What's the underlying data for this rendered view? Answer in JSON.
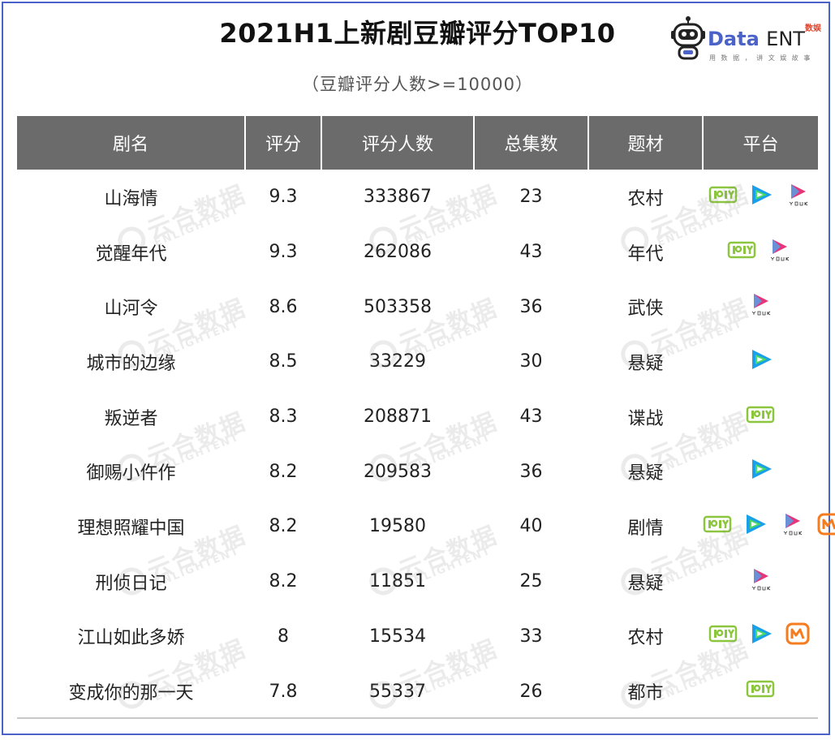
{
  "title": "2021H1上新剧豆瓣评分TOP10",
  "subtitle": "（豆瓣评分人数>=10000）",
  "logo": {
    "brand_data": "Data",
    "brand_ent": "ENT",
    "badge": "数娱",
    "tagline": "用 数 据 ， 讲 文 娱 故 事"
  },
  "watermark": {
    "cn": "云合数据",
    "en": "ENLIGHTENT"
  },
  "colors": {
    "header_bg": "#6b6b6b",
    "frame": "#4b63c9",
    "iqiyi": "#8cc63f",
    "youku": "#e6367a",
    "tencent": "#1aa0e8",
    "mango": "#f57c1f"
  },
  "chart_data": {
    "type": "table",
    "columns": [
      "剧名",
      "评分",
      "评分人数",
      "总集数",
      "题材",
      "平台"
    ],
    "rows": [
      {
        "name": "山海情",
        "score": "9.3",
        "raters": "333867",
        "episodes": "23",
        "genre": "农村",
        "platforms": [
          "iqiyi",
          "tencent",
          "youku"
        ]
      },
      {
        "name": "觉醒年代",
        "score": "9.3",
        "raters": "262086",
        "episodes": "43",
        "genre": "年代",
        "platforms": [
          "iqiyi",
          "youku"
        ]
      },
      {
        "name": "山河令",
        "score": "8.6",
        "raters": "503358",
        "episodes": "36",
        "genre": "武侠",
        "platforms": [
          "youku"
        ]
      },
      {
        "name": "城市的边缘",
        "score": "8.5",
        "raters": "33229",
        "episodes": "30",
        "genre": "悬疑",
        "platforms": [
          "tencent"
        ]
      },
      {
        "name": "叛逆者",
        "score": "8.3",
        "raters": "208871",
        "episodes": "43",
        "genre": "谍战",
        "platforms": [
          "iqiyi"
        ]
      },
      {
        "name": "御赐小仵作",
        "score": "8.2",
        "raters": "209583",
        "episodes": "36",
        "genre": "悬疑",
        "platforms": [
          "tencent"
        ]
      },
      {
        "name": "理想照耀中国",
        "score": "8.2",
        "raters": "19580",
        "episodes": "40",
        "genre": "剧情",
        "platforms": [
          "iqiyi",
          "tencent",
          "youku",
          "mango"
        ]
      },
      {
        "name": "刑侦日记",
        "score": "8.2",
        "raters": "11851",
        "episodes": "25",
        "genre": "悬疑",
        "platforms": [
          "youku"
        ]
      },
      {
        "name": "江山如此多娇",
        "score": "8",
        "raters": "15534",
        "episodes": "33",
        "genre": "农村",
        "platforms": [
          "iqiyi",
          "tencent",
          "mango"
        ]
      },
      {
        "name": "变成你的那一天",
        "score": "7.8",
        "raters": "55337",
        "episodes": "26",
        "genre": "都市",
        "platforms": [
          "iqiyi"
        ]
      }
    ]
  }
}
